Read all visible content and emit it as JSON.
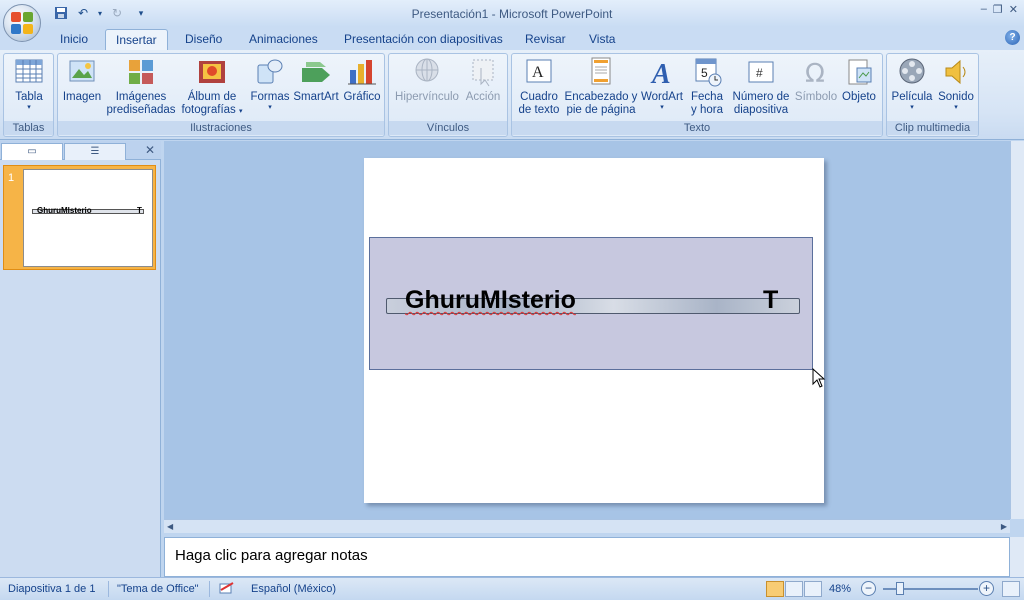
{
  "window": {
    "title": "Presentación1 - Microsoft PowerPoint",
    "controls": [
      "–",
      "❐",
      "✕"
    ]
  },
  "tabs": [
    {
      "label": "Inicio"
    },
    {
      "label": "Insertar",
      "active": true
    },
    {
      "label": "Diseño"
    },
    {
      "label": "Animaciones"
    },
    {
      "label": "Presentación con diapositivas"
    },
    {
      "label": "Revisar"
    },
    {
      "label": "Vista"
    }
  ],
  "ribbon": {
    "groups": {
      "tablas": "Tablas",
      "ilustraciones": "Ilustraciones",
      "vinculos": "Vínculos",
      "texto": "Texto",
      "clip": "Clip multimedia"
    },
    "buttons": {
      "tabla": "Tabla",
      "imagen": "Imagen",
      "imagenes_1": "Imágenes",
      "imagenes_2": "prediseñadas",
      "album_1": "Álbum de",
      "album_2": "fotografías",
      "formas": "Formas",
      "smartart": "SmartArt",
      "grafico": "Gráfico",
      "hipervinculo": "Hipervínculo",
      "accion": "Acción",
      "cuadro_1": "Cuadro",
      "cuadro_2": "de texto",
      "encabezado_1": "Encabezado y",
      "encabezado_2": "pie de página",
      "wordart": "WordArt",
      "fecha_1": "Fecha",
      "fecha_2": "y hora",
      "numero_1": "Número de",
      "numero_2": "diapositiva",
      "simbolo": "Símbolo",
      "objeto": "Objeto",
      "pelicula": "Película",
      "sonido": "Sonido"
    }
  },
  "left_pane": {
    "slide_number": "1",
    "thumb_title": "GhuruMIsterio",
    "thumb_t": "T"
  },
  "slide": {
    "title": "GhuruMIsterio",
    "t_char": "T"
  },
  "notes": {
    "placeholder": "Haga clic para agregar notas"
  },
  "status": {
    "slide_info": "Diapositiva 1 de 1",
    "theme": "\"Tema de Office\"",
    "language": "Español (México)",
    "zoom": "48%",
    "zoom_minus": "−",
    "zoom_plus": "+"
  },
  "colors": {
    "accent_orange": "#f6b447",
    "ribbon_text": "#15428b",
    "selection_fill": "#c7c8df"
  }
}
